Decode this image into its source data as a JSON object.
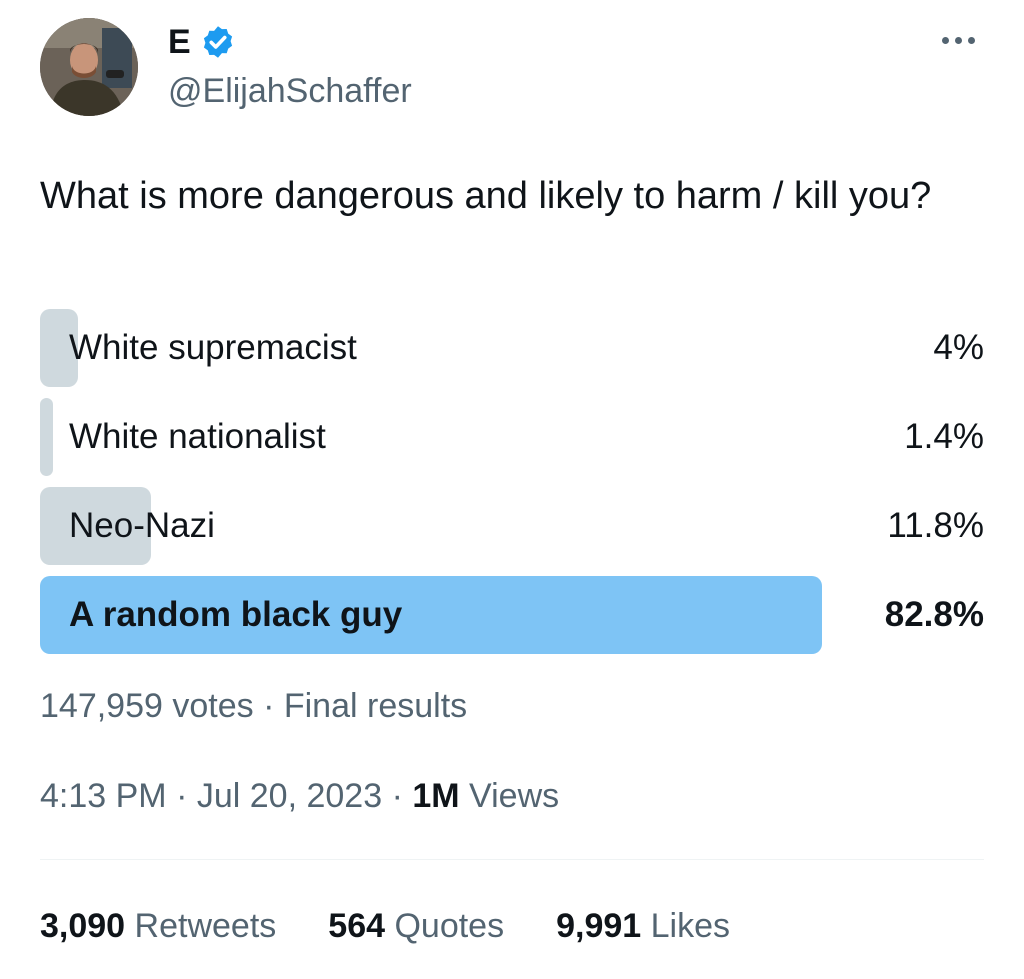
{
  "author": {
    "display_name": "E",
    "handle": "@ElijahSchaffer",
    "verified_icon": "verified-badge-icon",
    "avatar_icon": "avatar-photo"
  },
  "tweet": {
    "text": "What is more dangerous and likely to harm / kill you?"
  },
  "poll": {
    "options": [
      {
        "label": "White supremacist",
        "percent": "4%",
        "value": 4,
        "winner": false
      },
      {
        "label": "White nationalist",
        "percent": "1.4%",
        "value": 1.4,
        "winner": false
      },
      {
        "label": "Neo-Nazi",
        "percent": "11.8%",
        "value": 11.8,
        "winner": false
      },
      {
        "label": "A random black guy",
        "percent": "82.8%",
        "value": 82.8,
        "winner": true
      }
    ],
    "votes": "147,959 votes",
    "status": "Final results"
  },
  "meta": {
    "time": "4:13 PM",
    "date": "Jul 20, 2023",
    "views_count": "1M",
    "views_label": "Views"
  },
  "stats": {
    "retweets_count": "3,090",
    "retweets_label": "Retweets",
    "quotes_count": "564",
    "quotes_label": "Quotes",
    "likes_count": "9,991",
    "likes_label": "Likes"
  },
  "colors": {
    "winner_bar": "#7ec4f5",
    "other_bar": "#cfd9de",
    "secondary_text": "#536471",
    "verified": "#1d9bf0"
  }
}
